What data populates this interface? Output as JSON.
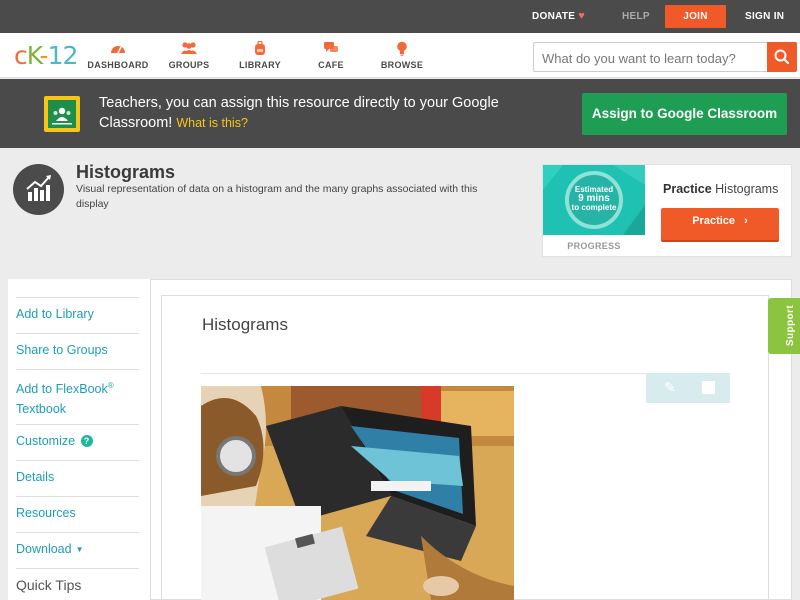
{
  "topbar": {
    "donate": "DONATE",
    "help": "HELP",
    "join": "JOIN",
    "signin": "SIGN IN"
  },
  "nav": {
    "logo": {
      "c": "c",
      "k": "K",
      "dash": "-",
      "n": "12"
    },
    "items": [
      {
        "label": "DASHBOARD",
        "icon": "dashboard-gauge-icon"
      },
      {
        "label": "GROUPS",
        "icon": "people-icon"
      },
      {
        "label": "LIBRARY",
        "icon": "backpack-icon"
      },
      {
        "label": "CAFE",
        "icon": "chat-bubbles-icon"
      },
      {
        "label": "BROWSE",
        "icon": "lightbulb-icon"
      }
    ],
    "search_placeholder": "What do you want to learn today?"
  },
  "banner": {
    "text": "Teachers, you can assign this resource directly to your Google Classroom!",
    "link": "What is this?",
    "assign_button": "Assign to Google Classroom"
  },
  "concept": {
    "title": "Histograms",
    "description": "Visual representation of data on a histogram and the many graphs associated with this display"
  },
  "practice": {
    "ring_line1": "Estimated",
    "ring_line2": "9 mins",
    "ring_line3": "to complete",
    "progress_label": "PROGRESS",
    "heading_bold": "Practice",
    "heading_rest": "Histograms",
    "button": "Practice"
  },
  "sidebar": {
    "add_library": "Add to Library",
    "share_groups": "Share to Groups",
    "add_flexbook_1": "Add to FlexBook",
    "add_flexbook_sup": "®",
    "add_flexbook_2": "Textbook",
    "customize": "Customize",
    "details": "Details",
    "resources": "Resources",
    "download": "Download",
    "quick_tips": "Quick Tips"
  },
  "content": {
    "title": "Histograms"
  },
  "support": "Support",
  "colors": {
    "brand_orange": "#f05a28",
    "google_green": "#1e9e52",
    "link_teal": "#1e9fb4",
    "support_green": "#8bc53f"
  }
}
